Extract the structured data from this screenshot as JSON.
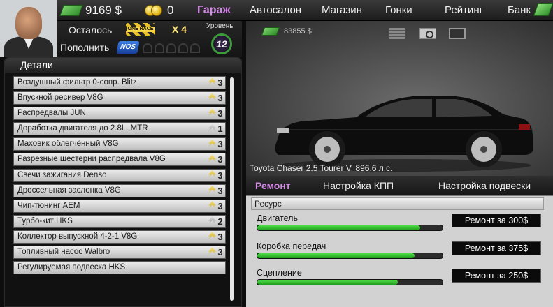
{
  "top": {
    "cash": "9169 $",
    "coins": "0",
    "nav": [
      "Гараж",
      "Автосалон",
      "Магазин",
      "Гонки",
      "Рейтинг",
      "Банк"
    ],
    "active_nav": "Гараж"
  },
  "player": {
    "remaining_label": "Осталось",
    "race_badge": "ONE RACE",
    "race_count": "X 4",
    "refill_label": "Пополнить",
    "nos_label": "NOS",
    "level_label": "Уровень",
    "level": "12"
  },
  "details": {
    "title": "Детали",
    "parts": [
      {
        "name": "Воздушный фильтр 0-сопр. Blitz",
        "grade": "3",
        "tier": "gold"
      },
      {
        "name": "Впускной ресивер V8G",
        "grade": "3",
        "tier": "gold"
      },
      {
        "name": "Распредвалы JUN",
        "grade": "3",
        "tier": "gold"
      },
      {
        "name": "Доработка двигателя до 2.8L. MTR",
        "grade": "1",
        "tier": "gray"
      },
      {
        "name": "Маховик облегчённый V8G",
        "grade": "3",
        "tier": "gold"
      },
      {
        "name": "Разрезные шестерни распредвала V8G",
        "grade": "3",
        "tier": "gold"
      },
      {
        "name": "Свечи зажигания Denso",
        "grade": "3",
        "tier": "gold"
      },
      {
        "name": "Дроссельная заслонка V8G",
        "grade": "3",
        "tier": "gold"
      },
      {
        "name": "Чип-тюнинг AEM",
        "grade": "3",
        "tier": "gold"
      },
      {
        "name": "Турбо-кит HKS",
        "grade": "2",
        "tier": "gray"
      },
      {
        "name": "Коллектор выпускной 4-2-1 V8G",
        "grade": "3",
        "tier": "gold"
      },
      {
        "name": "Топливный насос Walbro",
        "grade": "3",
        "tier": "gold"
      },
      {
        "name": "Регулируемая подвеска HKS",
        "grade": "",
        "tier": "none"
      }
    ]
  },
  "car": {
    "price": "83855 $",
    "caption": "Toyota Chaser 2.5 Tourer V, 896.6 л.с.",
    "view_icons": [
      "garage-icon",
      "camera-icon",
      "screen-icon"
    ]
  },
  "tabs": {
    "items": [
      "Ремонт",
      "Настройка КПП",
      "Настройка подвески"
    ],
    "active": "Ремонт"
  },
  "repair": {
    "resource_label": "Ресурс",
    "items": [
      {
        "label": "Двигатель",
        "level": 0.88,
        "button": "Ремонт за 300$"
      },
      {
        "label": "Коробка передач",
        "level": 0.85,
        "button": "Ремонт за 375$"
      },
      {
        "label": "Сцепление",
        "level": 0.76,
        "button": "Ремонт за 250$"
      }
    ]
  },
  "colors": {
    "accent": "#d38be6",
    "progress_green": "#2fb82b",
    "gold": "#e3b81b"
  }
}
